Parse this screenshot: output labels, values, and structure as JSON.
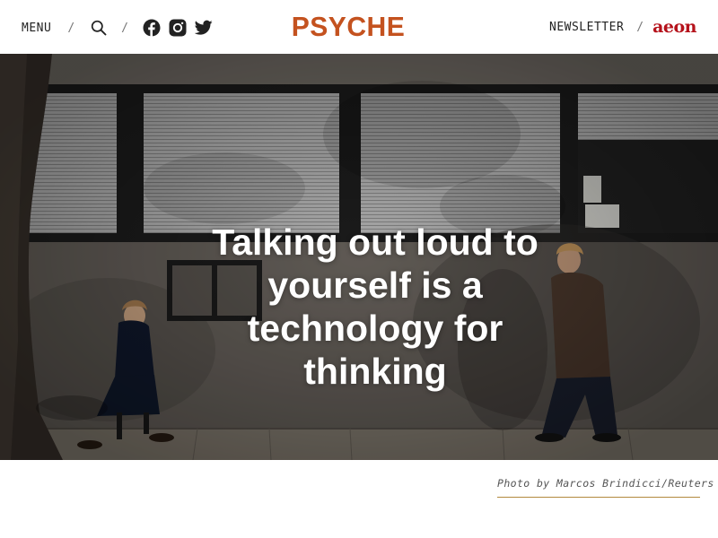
{
  "header": {
    "menu_label": "MENU",
    "separator": "/",
    "search_icon": "search-icon",
    "social_icons": [
      "facebook-icon",
      "instagram-icon",
      "twitter-icon"
    ],
    "logo_text": "PSYCHE",
    "newsletter_label": "NEWSLETTER",
    "partner_logo_text": "aeon"
  },
  "hero": {
    "title": "Talking out loud to yourself is a technology for thinking",
    "caption": "Photo by Marcos Brindicci/Reuters"
  },
  "colors": {
    "logo": "#c4521f",
    "partner_logo": "#b5121b",
    "caption_rule": "#b38a3e"
  }
}
